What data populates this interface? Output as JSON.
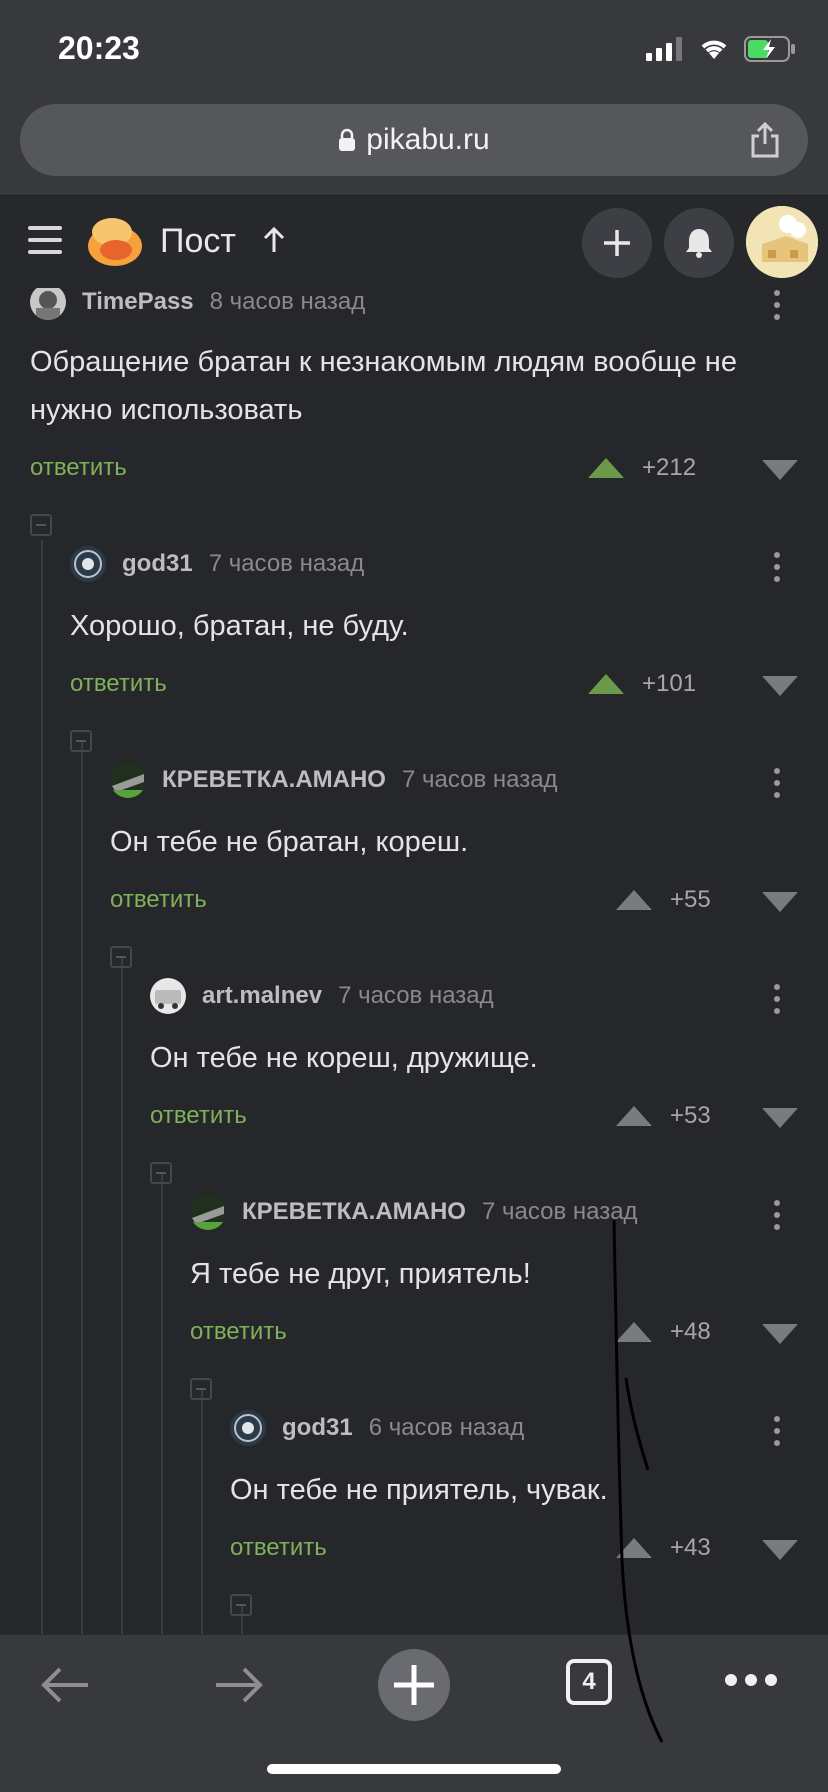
{
  "status": {
    "time": "20:23"
  },
  "browser": {
    "url": "pikabu.ru",
    "tabs_count": "4"
  },
  "header": {
    "title": "Пост"
  },
  "comments": [
    {
      "author": "TimePass",
      "time": "8 часов назад",
      "text": "Обращение братан к незнакомым людям вообще не нужно использовать",
      "reply": "ответить",
      "votes": "+212",
      "upvoted": true
    },
    {
      "author": "god31",
      "time": "7 часов назад",
      "text": "Хорошо, братан, не буду.",
      "reply": "ответить",
      "votes": "+101",
      "upvoted": true
    },
    {
      "author": "КРЕВЕТКА.АМАНО",
      "time": "7 часов назад",
      "text": "Он тебе не братан, кореш.",
      "reply": "ответить",
      "votes": "+55",
      "upvoted": false
    },
    {
      "author": "art.malnev",
      "time": "7 часов назад",
      "text": "Он тебе не кореш, дружище.",
      "reply": "ответить",
      "votes": "+53",
      "upvoted": false
    },
    {
      "author": "КРЕВЕТКА.АМАНО",
      "time": "7 часов назад",
      "text": "Я тебе не друг, приятель!",
      "reply": "ответить",
      "votes": "+48",
      "upvoted": false
    },
    {
      "author": "god31",
      "time": "6 часов назад",
      "text": "Он тебе не приятель, чувак.",
      "reply": "ответить",
      "votes": "+43",
      "upvoted": false
    }
  ],
  "colors": {
    "background": "#25272b",
    "reply": "#7fb05a",
    "upvote_active": "#6a9a4a"
  }
}
